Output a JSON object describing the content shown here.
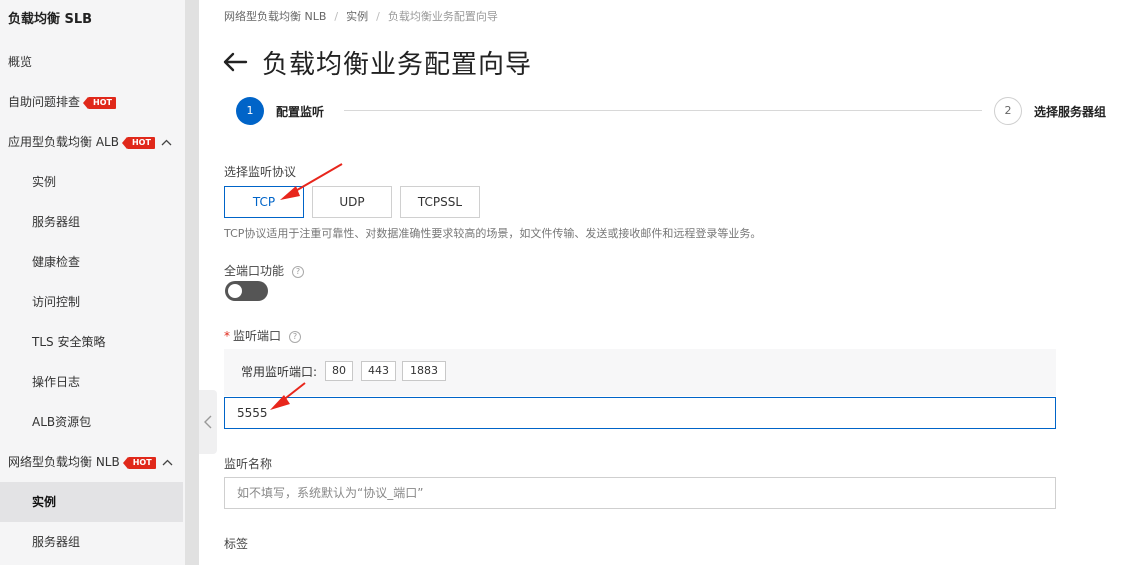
{
  "sidebar": {
    "title": "负载均衡 SLB",
    "items": [
      {
        "label": "概览"
      },
      {
        "label": "自助问题排查",
        "badge": "HOT"
      },
      {
        "label": "应用型负载均衡 ALB",
        "badge": "HOT"
      },
      {
        "label": "实例"
      },
      {
        "label": "服务器组"
      },
      {
        "label": "健康检查"
      },
      {
        "label": "访问控制"
      },
      {
        "label": "TLS 安全策略"
      },
      {
        "label": "操作日志"
      },
      {
        "label": "ALB资源包"
      },
      {
        "label": "网络型负载均衡 NLB",
        "badge": "HOT"
      },
      {
        "label": "实例"
      },
      {
        "label": "服务器组"
      }
    ]
  },
  "breadcrumb": [
    "网络型负载均衡 NLB",
    "实例",
    "负载均衡业务配置向导"
  ],
  "page": {
    "title": "负载均衡业务配置向导"
  },
  "steps": [
    {
      "num": "1",
      "label": "配置监听"
    },
    {
      "num": "2",
      "label": "选择服务器组"
    }
  ],
  "form": {
    "protocol_label": "选择监听协议",
    "protocols": [
      "TCP",
      "UDP",
      "TCPSSL"
    ],
    "selected_protocol": "TCP",
    "protocol_desc": "TCP协议适用于注重可靠性、对数据准确性要求较高的场景，如文件传输、发送或接收邮件和远程登录等业务。",
    "all_ports_label": "全端口功能",
    "all_ports_enabled": false,
    "port_required_mark": "*",
    "port_label": "监听端口",
    "common_ports_label": "常用监听端口:",
    "common_ports": [
      "80",
      "443",
      "1883"
    ],
    "port_value": "5555",
    "name_label": "监听名称",
    "name_placeholder": "如不填写，系统默认为“协议_端口”",
    "tags_label": "标签"
  },
  "colors": {
    "primary": "#0064c8",
    "hot_badge": "#e0281a",
    "annotation_arrow": "#e8261c"
  }
}
